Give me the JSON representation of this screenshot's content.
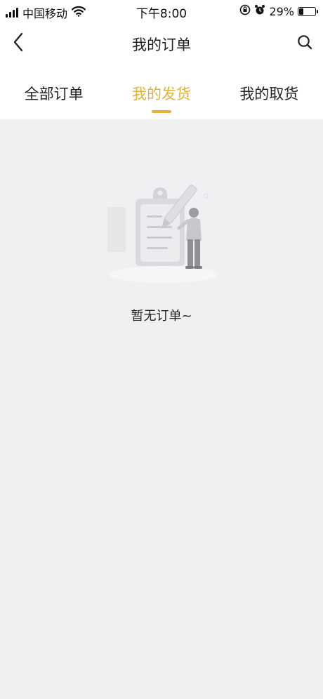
{
  "status_bar": {
    "carrier": "中国移动",
    "time": "下午8:00",
    "battery": "29%",
    "battery_level": 0.29
  },
  "nav": {
    "title": "我的订单",
    "back_icon": "chevron-left-icon",
    "search_icon": "search-icon"
  },
  "tabs": [
    {
      "label": "全部订单",
      "active": false
    },
    {
      "label": "我的发货",
      "active": true
    },
    {
      "label": "我的取货",
      "active": false
    }
  ],
  "colors": {
    "accent": "#e2b13c",
    "background": "#f0f0f3",
    "bar": "#ffffff"
  },
  "empty_state": {
    "message": "暂无订单~",
    "illustration": "clipboard-person-illustration"
  }
}
